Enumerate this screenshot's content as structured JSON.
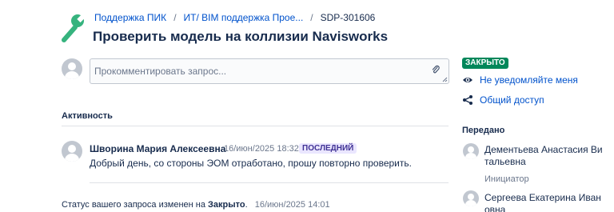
{
  "breadcrumb": {
    "items": [
      "Поддержка ПИК",
      "ИТ/ BIM поддержка Прое..."
    ],
    "key": "SDP-301606",
    "separator": "/"
  },
  "title": "Проверить модель на коллизии Navisworks",
  "comment_input": {
    "placeholder": "Прокомментировать запрос..."
  },
  "activity": {
    "label": "Активность",
    "comments": [
      {
        "author": "Шворина Мария Алексеевна",
        "date": "16/июн/2025 18:32",
        "badge": "ПОСЛЕДНИЙ",
        "text": "Добрый день, со стороны ЭОМ отработано, прошу повторно проверить."
      }
    ],
    "status_change": {
      "prefix": "Статус вашего запроса изменен на",
      "status": "Закрыто",
      "suffix": ".",
      "date": "16/июн/2025 14:01"
    }
  },
  "sidebar": {
    "status": "ЗАКРЫТО",
    "status_color": "#00875a",
    "notify_label": "Не уведомляйте меня",
    "notify_icon": "eye-icon",
    "share_label": "Общий доступ",
    "share_icon": "share-icon",
    "shared_with_label": "Передано",
    "people": [
      {
        "name": "Дементьева Анастасия Ви тальевна",
        "role": "Инициатор"
      },
      {
        "name": "Сергеева Екатерина Иван овна",
        "role": ""
      }
    ]
  }
}
